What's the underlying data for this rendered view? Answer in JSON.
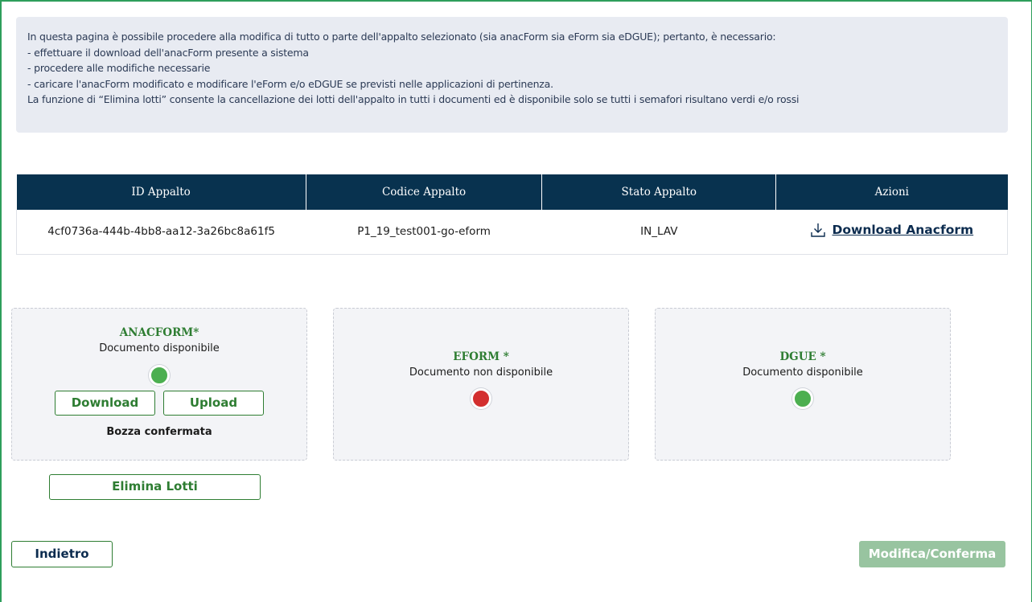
{
  "info": {
    "lines": [
      "In questa pagina è possibile procedere alla modifica di tutto o parte dell'appalto selezionato (sia anacForm sia eForm sia eDGUE); pertanto, è necessario:",
      "- effettuare il download dell'anacForm presente a sistema",
      "- procedere alle modifiche necessarie",
      "- caricare l'anacForm modificato e modificare l'eForm e/o eDGUE se previsti nelle applicazioni di pertinenza.",
      "La funzione di “Elimina lotti” consente la cancellazione dei lotti dell'appalto in tutti i documenti ed è disponibile solo se tutti i semafori risultano verdi e/o rossi"
    ]
  },
  "table": {
    "headers": [
      "ID Appalto",
      "Codice Appalto",
      "Stato Appalto",
      "Azioni"
    ],
    "row": {
      "id": "4cf0736a-444b-4bb8-aa12-3a26bc8a61f5",
      "codice": "P1_19_test001-go-eform",
      "stato": "IN_LAV",
      "azione": "Download Anacform"
    }
  },
  "cards": {
    "anacform": {
      "title": "ANACFORM*",
      "subtitle": "Documento disponibile",
      "light": "green",
      "download_label": "Download",
      "upload_label": "Upload",
      "status": "Bozza confermata"
    },
    "eform": {
      "title": "EFORM *",
      "subtitle": "Documento non disponibile",
      "light": "red"
    },
    "dgue": {
      "title": "DGUE *",
      "subtitle": "Documento disponibile",
      "light": "green"
    }
  },
  "buttons": {
    "elimina": "Elimina Lotti",
    "indietro": "Indietro",
    "modifica": "Modifica/Conferma"
  },
  "colors": {
    "header_bg": "#08324f",
    "accent_green": "#2e7d32",
    "light_green": "#4caf50",
    "light_red": "#d32f2f",
    "disabled_green": "#98c4a0"
  }
}
